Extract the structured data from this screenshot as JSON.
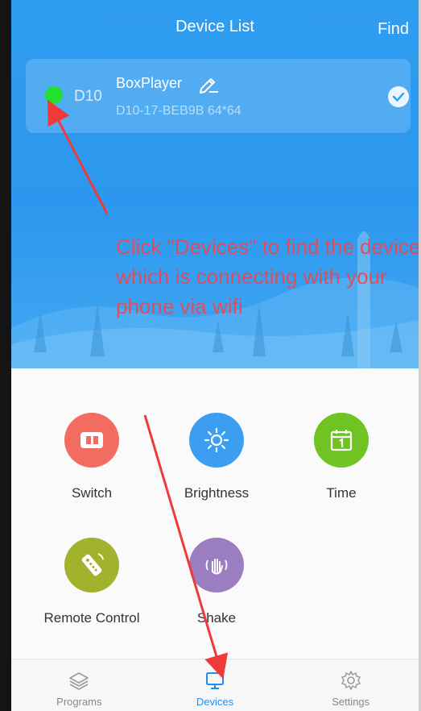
{
  "header": {
    "title": "Device List",
    "find_label": "Find"
  },
  "device": {
    "status": "online",
    "model": "D10",
    "name": "BoxPlayer",
    "id_line": "D10-17-BEB9B  64*64",
    "selected": true
  },
  "annotation": {
    "text": "Click \"Devices\" to find the device which is connecting with your phone via wifi",
    "color": "#f0454f"
  },
  "functions": [
    {
      "label": "Switch",
      "icon": "switch-icon",
      "color": "#f26d60"
    },
    {
      "label": "Brightness",
      "icon": "brightness-icon",
      "color": "#3c9ef0"
    },
    {
      "label": "Time",
      "icon": "calendar-icon",
      "color": "#6fc423"
    },
    {
      "label": "Remote Control",
      "icon": "remote-control-icon",
      "color": "#a2b22c"
    },
    {
      "label": "Shake",
      "icon": "shake-icon",
      "color": "#9b7ec2"
    }
  ],
  "tabs": [
    {
      "label": "Programs",
      "icon": "layers-icon",
      "active": false
    },
    {
      "label": "Devices",
      "icon": "monitor-icon",
      "active": true
    },
    {
      "label": "Settings",
      "icon": "gear-icon",
      "active": false
    }
  ],
  "colors": {
    "header_blue": "#2f9df0",
    "online_green": "#22e02e",
    "active_tab": "#1e8ff0"
  }
}
